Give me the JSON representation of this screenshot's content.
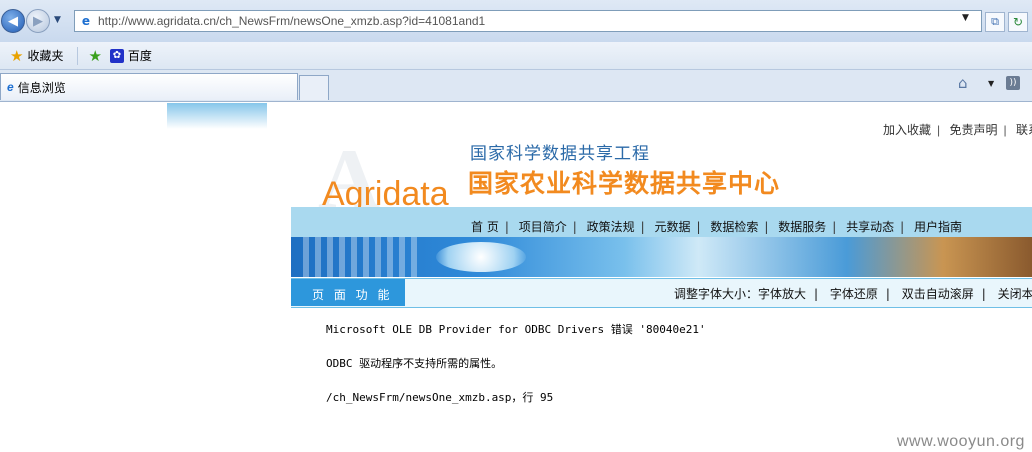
{
  "browser": {
    "url": "http://www.agridata.cn/ch_NewsFrm/newsOne_xmzb.asp?id=41081and1",
    "favorites_label": "收藏夹",
    "bookmark_label": "百度",
    "tab_title": "信息浏览"
  },
  "page": {
    "top_links": [
      "加入收藏",
      "免责声明",
      "联系"
    ],
    "logo": {
      "big_letter": "A",
      "english": "Agridata",
      "title1": "国家科学数据共享工程",
      "title2": "国家农业科学数据共享中心"
    },
    "nav": [
      "首 页",
      "项目简介",
      "政策法规",
      "元数据",
      "数据检索",
      "数据服务",
      "共享动态",
      "用户指南"
    ],
    "function_bar": {
      "label": "页 面 功 能",
      "links": [
        "调整字体大小：字体放大",
        "字体还原",
        "双击自动滚屏",
        "关闭本页"
      ]
    },
    "errors": {
      "line1": "Microsoft OLE DB Provider for ODBC Drivers 错误 '80040e21'",
      "line2": "ODBC 驱动程序不支持所需的属性。",
      "line3": "/ch_NewsFrm/newsOne_xmzb.asp，行 95"
    }
  },
  "watermark": "www.wooyun.org",
  "colors": {
    "brand_orange": "#f28a1f",
    "brand_blue": "#2b6aa8",
    "nav_band": "#a9d9ef",
    "func_tab": "#2d97dc"
  }
}
